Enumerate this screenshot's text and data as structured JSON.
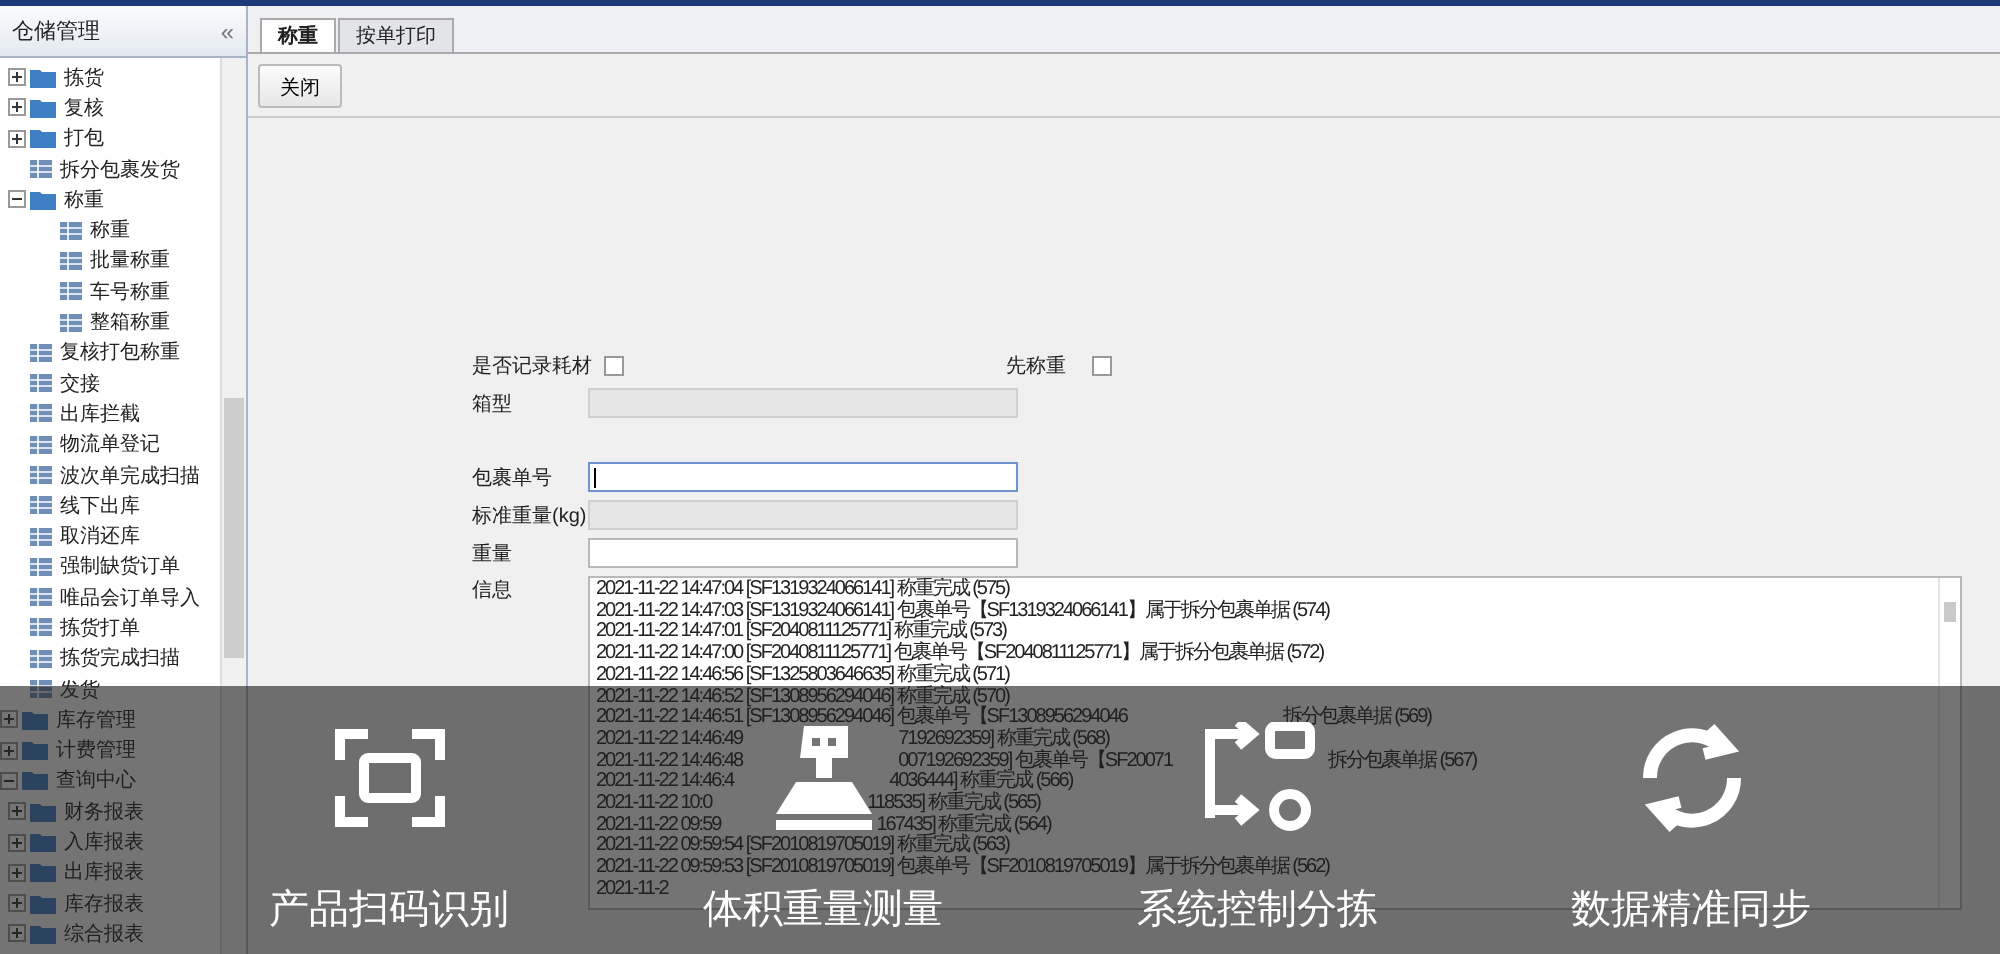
{
  "sidebar": {
    "title": "仓储管理",
    "collapse_glyph": "«",
    "tree": [
      {
        "kind": "group",
        "children": [
          {
            "label": "拣货",
            "kind": "folder",
            "expanded": false
          },
          {
            "label": "复核",
            "kind": "folder",
            "expanded": false
          },
          {
            "label": "打包",
            "kind": "folder",
            "expanded": false
          },
          {
            "label": "拆分包裹发货",
            "kind": "leaf"
          },
          {
            "label": "称重",
            "kind": "folder",
            "expanded": true,
            "children": [
              {
                "label": "称重",
                "kind": "leaf"
              },
              {
                "label": "批量称重",
                "kind": "leaf"
              },
              {
                "label": "车号称重",
                "kind": "leaf"
              },
              {
                "label": "整箱称重",
                "kind": "leaf"
              }
            ]
          },
          {
            "label": "复核打包称重",
            "kind": "leaf"
          },
          {
            "label": "交接",
            "kind": "leaf"
          },
          {
            "label": "出库拦截",
            "kind": "leaf"
          },
          {
            "label": "物流单登记",
            "kind": "leaf"
          },
          {
            "label": "波次单完成扫描",
            "kind": "leaf"
          },
          {
            "label": "线下出库",
            "kind": "leaf"
          },
          {
            "label": "取消还库",
            "kind": "leaf"
          },
          {
            "label": "强制缺货订单",
            "kind": "leaf"
          },
          {
            "label": "唯品会订单导入",
            "kind": "leaf"
          },
          {
            "label": "拣货打单",
            "kind": "leaf"
          },
          {
            "label": "拣货完成扫描",
            "kind": "leaf"
          },
          {
            "label": "发货",
            "kind": "leaf"
          }
        ]
      },
      {
        "label": "库存管理",
        "kind": "folder",
        "expanded": false
      },
      {
        "label": "计费管理",
        "kind": "folder",
        "expanded": false
      },
      {
        "label": "查询中心",
        "kind": "folder",
        "expanded": true,
        "children": [
          {
            "label": "财务报表",
            "kind": "folder",
            "expanded": false
          },
          {
            "label": "入库报表",
            "kind": "folder",
            "expanded": false
          },
          {
            "label": "出库报表",
            "kind": "folder",
            "expanded": false
          },
          {
            "label": "库存报表",
            "kind": "folder",
            "expanded": false
          },
          {
            "label": "综合报表",
            "kind": "folder",
            "expanded": false
          }
        ]
      }
    ]
  },
  "tabs": [
    {
      "label": "称重",
      "selected": true
    },
    {
      "label": "按单打印",
      "selected": false
    }
  ],
  "toolbar": {
    "close_button": "关闭"
  },
  "options": [
    {
      "label": "是否记录耗材",
      "checked": false
    },
    {
      "label": "先称重",
      "checked": false
    }
  ],
  "fields": [
    {
      "label": "箱型",
      "disabled": true,
      "focused": false
    },
    {
      "label": "包裹单号",
      "disabled": false,
      "focused": true
    },
    {
      "label": "标准重量(kg)",
      "disabled": true,
      "focused": false
    },
    {
      "label": "重量",
      "disabled": false,
      "focused": false
    }
  ],
  "log": {
    "label": "信息",
    "lines": [
      {
        "text": "2021-11-22 14:47:04 [SF1319324066141] 称重完成 (575)"
      },
      {
        "text": "2021-11-22 14:47:03 [SF1319324066141] 包裹单号【SF1319324066141】属于拆分包裹单据 (574)"
      },
      {
        "text": "2021-11-22 14:47:01 [SF2040811125771] 称重完成 (573)"
      },
      {
        "text": "2021-11-22 14:47:00 [SF2040811125771] 包裹单号【SF2040811125771】属于拆分包裹单据 (572)"
      },
      {
        "text": "2021-11-22 14:46:56 [SF1325803646635] 称重完成 (571)"
      },
      {
        "text": "2021-11-22 14:46:52 [SF1308956294046] 称重完成 (570)"
      },
      {
        "parts": [
          "2021-11-22 14:46:51 [SF1308956294046] 包裹单号【SF1308956294046",
          "拆分包裹单据 (569)"
        ]
      },
      {
        "parts": [
          "2021-11-22 14:46:49",
          "7192692359] 称重完成 (568)"
        ]
      },
      {
        "parts": [
          "2021-11-22 14:46:48",
          "007192692359] 包裹单号【SF20071",
          "拆分包裹单据 (567)"
        ]
      },
      {
        "parts": [
          "2021-11-22 14:46:4",
          "4036444] 称重完成 (566)"
        ]
      },
      {
        "parts": [
          "2021-11-22 10:0",
          "118535] 称重完成 (565)"
        ]
      },
      {
        "parts": [
          "2021-11-22 09:59",
          "167435] 称重完成 (564)"
        ]
      },
      {
        "text": "2021-11-22 09:59:54 [SF2010819705019] 称重完成 (563)"
      },
      {
        "text": "2021-11-22 09:59:53 [SF2010819705019] 包裹单号【SF2010819705019】属于拆分包裹单据 (562)"
      },
      {
        "text": "2021-11-2"
      }
    ]
  },
  "features": [
    {
      "kind": "scan",
      "caption": "产品扫码识别"
    },
    {
      "kind": "scale",
      "caption": "体积重量测量"
    },
    {
      "kind": "sort",
      "caption": "系统控制分拣"
    },
    {
      "kind": "sync",
      "caption": "数据精准同步"
    }
  ]
}
